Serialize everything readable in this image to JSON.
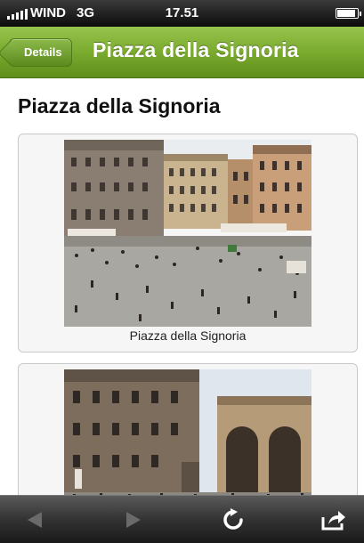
{
  "status_bar": {
    "carrier": "WIND",
    "network": "3G",
    "time": "17.51",
    "icons": [
      "signal-icon",
      "battery-icon"
    ]
  },
  "nav_bar": {
    "back_label": "Details",
    "title": "Piazza della Signoria",
    "color": "#7aaa2e"
  },
  "content": {
    "heading": "Piazza della Signoria",
    "images": [
      {
        "caption": "Piazza della Signoria"
      },
      {
        "caption": ""
      }
    ]
  },
  "toolbar": {
    "icons": [
      "back-arrow-icon",
      "forward-arrow-icon",
      "reload-icon",
      "share-icon"
    ]
  }
}
